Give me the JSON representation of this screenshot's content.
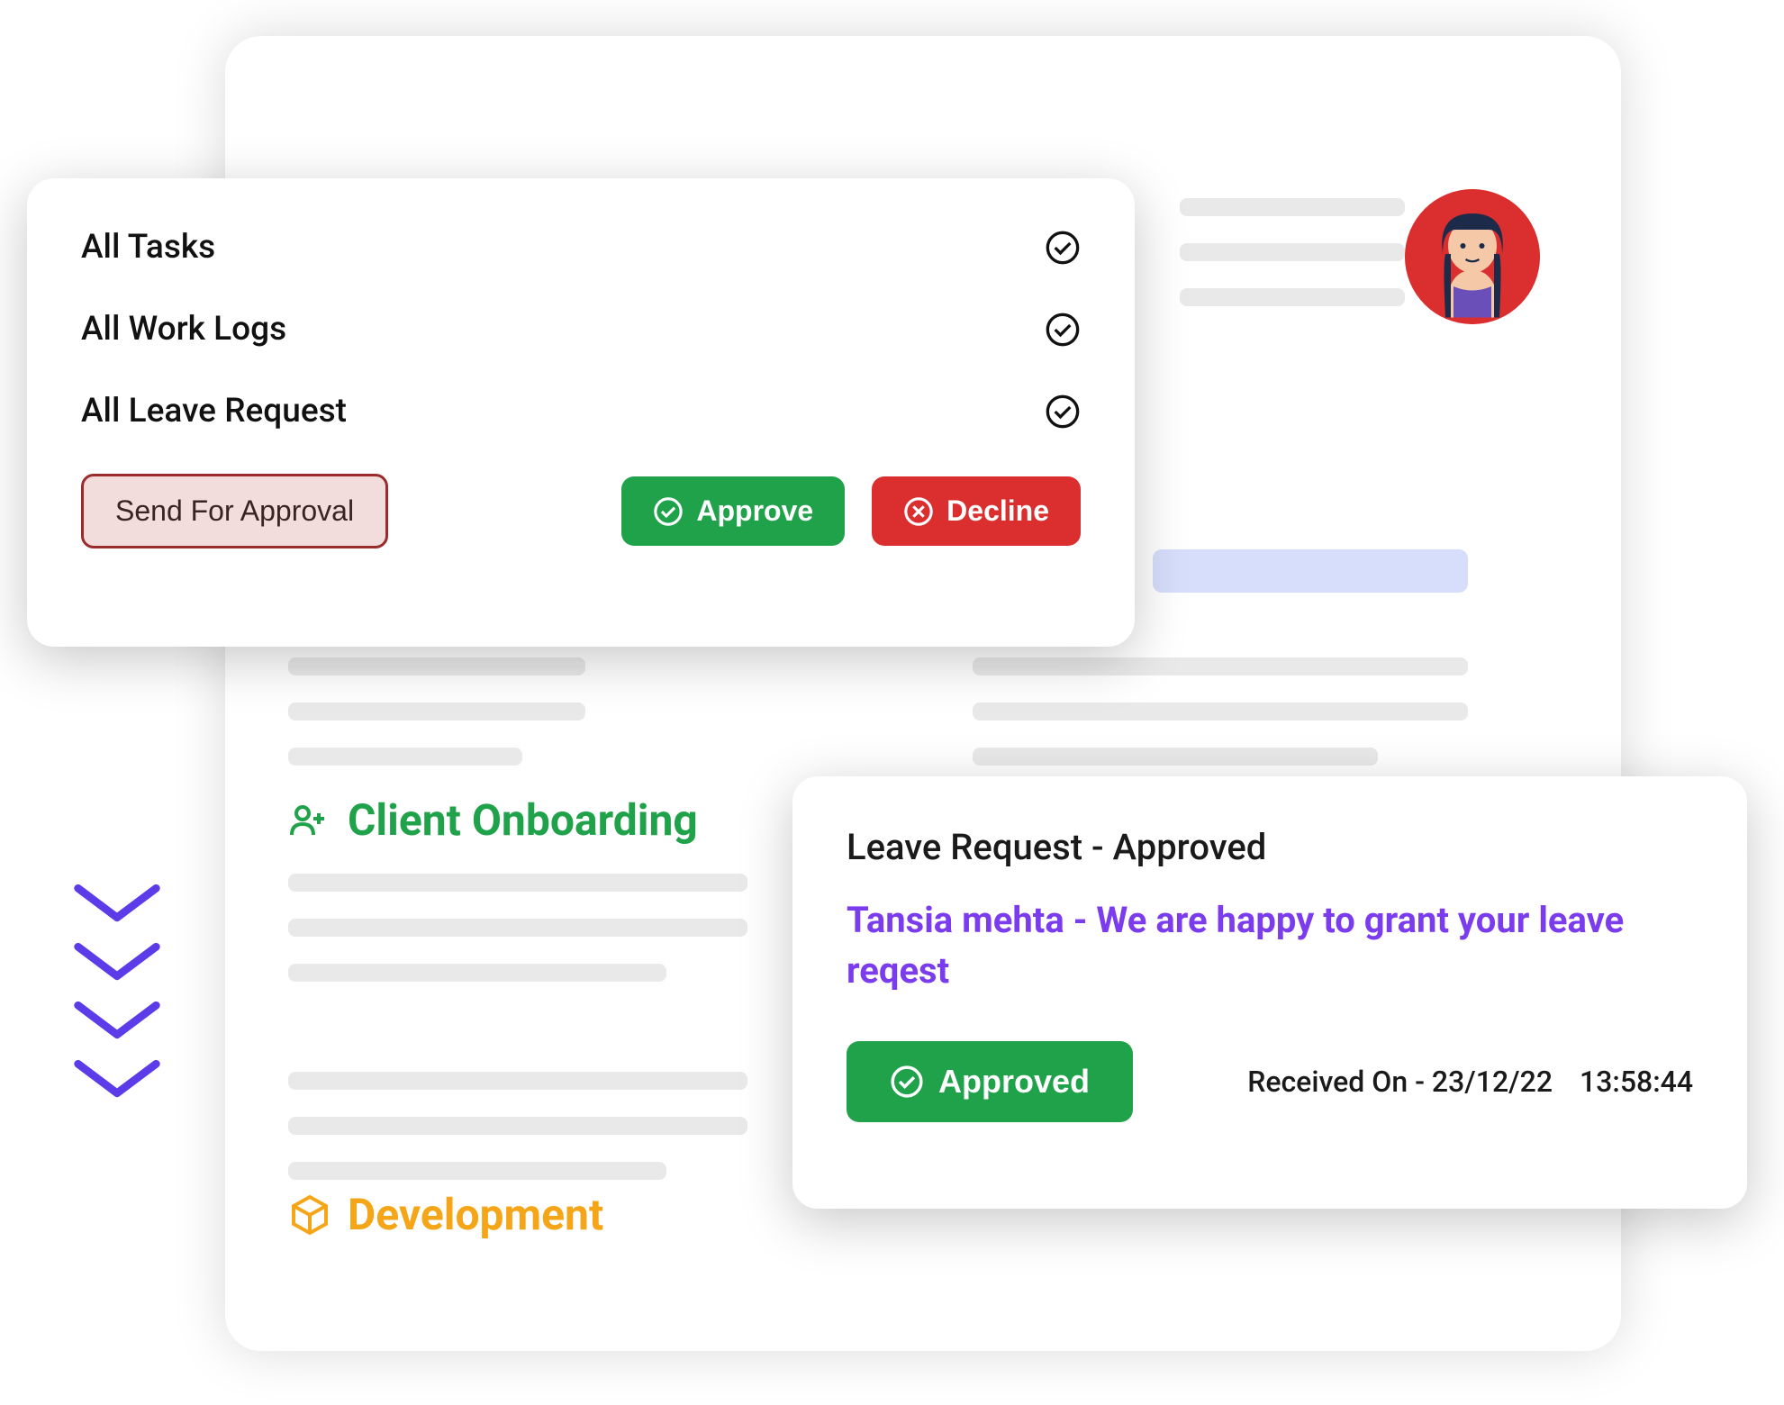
{
  "approval": {
    "items": [
      {
        "label": "All Tasks"
      },
      {
        "label": "All Work Logs"
      },
      {
        "label": "All Leave Request"
      }
    ],
    "send_label": "Send For Approval",
    "approve_label": "Approve",
    "decline_label": "Decline"
  },
  "sections": {
    "onboarding": "Client Onboarding",
    "development": "Development"
  },
  "leave": {
    "title": "Leave Request - Approved",
    "message": "Tansia mehta - We are happy to grant your leave reqest",
    "approved_label": "Approved",
    "received_prefix": "Received On - ",
    "received_date": "23/12/22",
    "received_time": "13:58:44"
  }
}
